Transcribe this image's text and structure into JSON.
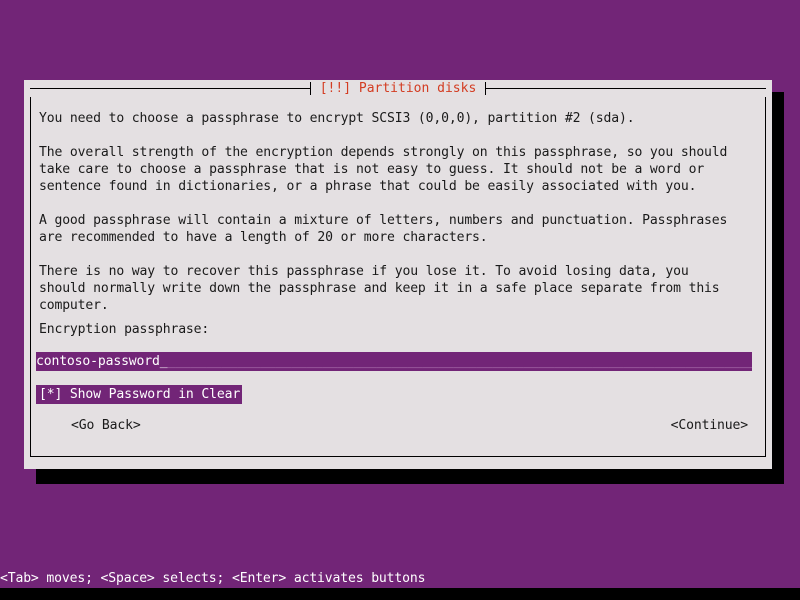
{
  "screen": {
    "background_color": "#722577",
    "panel_color": "#e4e0e2",
    "accent_color": "#d33c22",
    "highlight_color": "#722577"
  },
  "dialog": {
    "title": "[!!] Partition disks",
    "paragraphs": [
      "You need to choose a passphrase to encrypt SCSI3 (0,0,0), partition #2 (sda).",
      "The overall strength of the encryption depends strongly on this passphrase, so you should\ntake care to choose a passphrase that is not easy to guess. It should not be a word or\nsentence found in dictionaries, or a phrase that could be easily associated with you.",
      "A good passphrase will contain a mixture of letters, numbers and punctuation. Passphrases\nare recommended to have a length of 20 or more characters.",
      "There is no way to recover this passphrase if you lose it. To avoid losing data, you\nshould normally write down the passphrase and keep it in a safe place separate from this\ncomputer."
    ],
    "field": {
      "label": "Encryption passphrase:",
      "value": "contoso-password",
      "cursor": "_",
      "fill": "____________________________________________________________________________"
    },
    "checkbox": {
      "marker": "[*]",
      "label": "Show Password in Clear",
      "checked": "true",
      "text": "[*] Show Password in Clear"
    },
    "buttons": {
      "back": "<Go Back>",
      "continue": "<Continue>"
    }
  },
  "status": {
    "hint": "<Tab> moves; <Space> selects; <Enter> activates buttons"
  }
}
